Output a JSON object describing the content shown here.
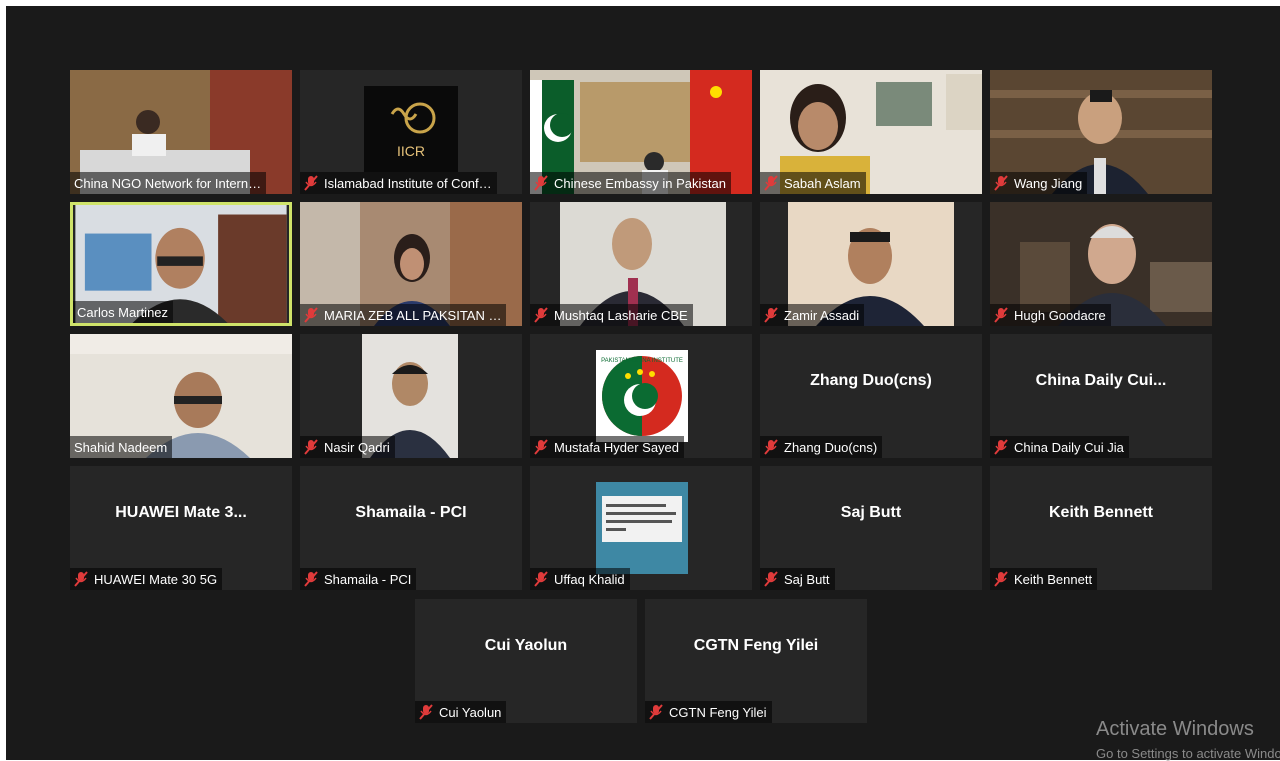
{
  "participants": [
    {
      "name": "China NGO Network for Intern…",
      "muted": false,
      "kind": "video"
    },
    {
      "name": "Islamabad Institute of Conf…",
      "muted": true,
      "kind": "logo",
      "logo_text": "IICR"
    },
    {
      "name": "Chinese Embassy in Pakistan",
      "muted": true,
      "kind": "video"
    },
    {
      "name": "Sabah Aslam",
      "muted": true,
      "kind": "video"
    },
    {
      "name": "Wang Jiang",
      "muted": true,
      "kind": "video"
    },
    {
      "name": "Carlos Martinez",
      "muted": false,
      "kind": "video",
      "active_speaker": true
    },
    {
      "name": "MARIA ZEB ALL PAKSITAN …",
      "muted": true,
      "kind": "video"
    },
    {
      "name": "Mushtaq Lasharie CBE",
      "muted": true,
      "kind": "video"
    },
    {
      "name": "Zamir Assadi",
      "muted": true,
      "kind": "video"
    },
    {
      "name": "Hugh Goodacre",
      "muted": true,
      "kind": "video"
    },
    {
      "name": "Shahid Nadeem",
      "muted": false,
      "kind": "video"
    },
    {
      "name": "Nasir Qadri",
      "muted": true,
      "kind": "video"
    },
    {
      "name": "Mustafa Hyder Sayed",
      "muted": true,
      "kind": "logo",
      "logo_text": "PAKISTAN-CHINA INSTITUTE"
    },
    {
      "name": "Zhang Duo(cns)",
      "muted": true,
      "kind": "text",
      "center": "Zhang Duo(cns)"
    },
    {
      "name": "China Daily Cui Jia",
      "muted": true,
      "kind": "text",
      "center": "China Daily Cui..."
    },
    {
      "name": "HUAWEI Mate 30 5G",
      "muted": true,
      "kind": "text",
      "center": "HUAWEI Mate 3..."
    },
    {
      "name": "Shamaila - PCI",
      "muted": true,
      "kind": "text",
      "center": "Shamaila - PCI"
    },
    {
      "name": "Uffaq Khalid",
      "muted": true,
      "kind": "image"
    },
    {
      "name": "Saj Butt",
      "muted": true,
      "kind": "text",
      "center": "Saj Butt"
    },
    {
      "name": "Keith Bennett",
      "muted": true,
      "kind": "text",
      "center": "Keith Bennett"
    },
    {
      "name": "Cui Yaolun",
      "muted": true,
      "kind": "text",
      "center": "Cui Yaolun"
    },
    {
      "name": "CGTN Feng Yilei",
      "muted": true,
      "kind": "text",
      "center": "CGTN Feng Yilei"
    }
  ],
  "watermark": {
    "title": "Activate Windows",
    "subtitle": "Go to Settings to activate Windows."
  },
  "colors": {
    "background": "#1a1a1a",
    "tile": "#262626",
    "active_border": "#cfe36a",
    "mute_icon": "#e03b3b"
  }
}
